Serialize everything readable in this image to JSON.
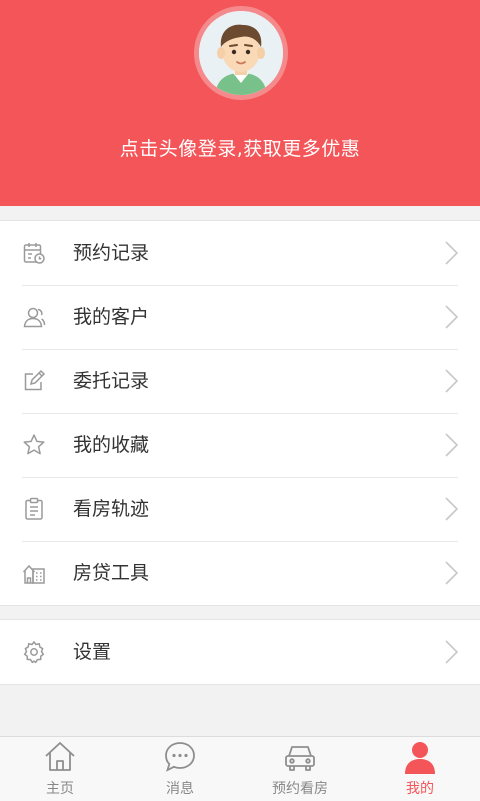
{
  "header": {
    "login_hint": "点击头像登录,获取更多优惠"
  },
  "menu": {
    "items": [
      {
        "label": "预约记录",
        "icon": "calendar-clock-icon"
      },
      {
        "label": "我的客户",
        "icon": "users-icon"
      },
      {
        "label": "委托记录",
        "icon": "edit-icon"
      },
      {
        "label": "我的收藏",
        "icon": "star-icon"
      },
      {
        "label": "看房轨迹",
        "icon": "clipboard-icon"
      },
      {
        "label": "房贷工具",
        "icon": "building-icon"
      }
    ],
    "settings": {
      "label": "设置",
      "icon": "gear-icon"
    }
  },
  "tabbar": {
    "tabs": [
      {
        "label": "主页",
        "icon": "home-icon"
      },
      {
        "label": "消息",
        "icon": "chat-icon"
      },
      {
        "label": "预约看房",
        "icon": "car-icon"
      },
      {
        "label": "我的",
        "icon": "person-icon",
        "active": true
      }
    ]
  },
  "colors": {
    "accent": "#f45559",
    "icon_gray": "#9a9a9a"
  }
}
